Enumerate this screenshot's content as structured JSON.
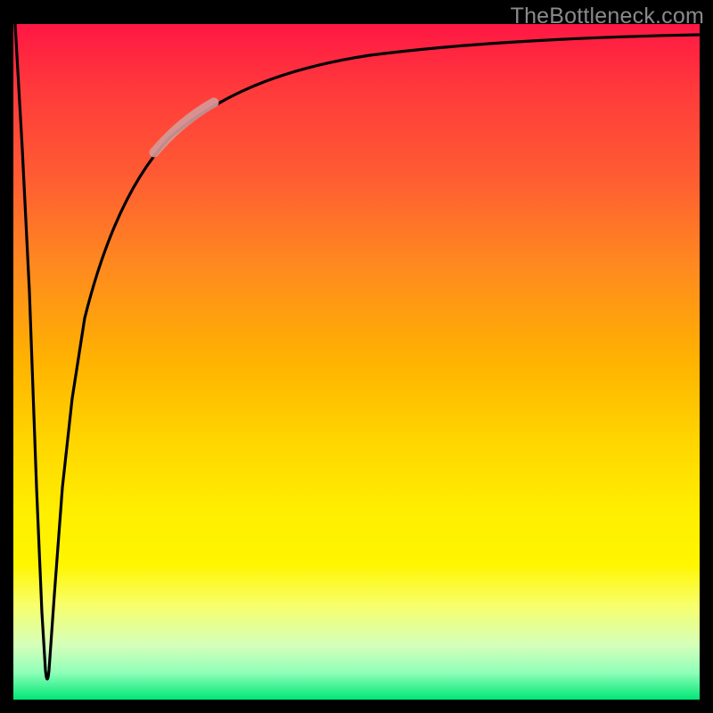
{
  "watermark": "TheBottleneck.com",
  "chart_data": {
    "type": "line",
    "title": "",
    "xlabel": "",
    "ylabel": "",
    "xlim": [
      0,
      100
    ],
    "ylim": [
      0,
      100
    ],
    "grid": false,
    "legend": false,
    "background_gradient": {
      "direction": "vertical",
      "stops": [
        {
          "pos": 0.0,
          "color": "#ff1744"
        },
        {
          "pos": 0.5,
          "color": "#ffb300"
        },
        {
          "pos": 0.8,
          "color": "#fff600"
        },
        {
          "pos": 1.0,
          "color": "#00e676"
        }
      ]
    },
    "series": [
      {
        "name": "bottleneck-curve",
        "x": [
          0.0,
          1.0,
          2.0,
          3.0,
          4.0,
          4.5,
          5.0,
          6.0,
          7.0,
          8.0,
          10.0,
          12.0,
          15.0,
          18.0,
          22.0,
          28.0,
          35.0,
          45.0,
          60.0,
          80.0,
          100.0
        ],
        "values": [
          100,
          75,
          50,
          20,
          5,
          2,
          5,
          25,
          40,
          50,
          62,
          70,
          77,
          82,
          86,
          89,
          91.5,
          93.5,
          95,
          96,
          96.5
        ],
        "note": "Valley minimum near x≈4.5, y≈2 (green). Curve rises steeply then asymptotes near y≈96."
      }
    ],
    "highlight_segment": {
      "name": "highlighted-band",
      "color": "#d49a9a",
      "approx_x_range": [
        22,
        30
      ],
      "approx_y_range": [
        77,
        85
      ]
    },
    "axis_color": "#000000",
    "axis_thickness_approx_px": 15
  }
}
